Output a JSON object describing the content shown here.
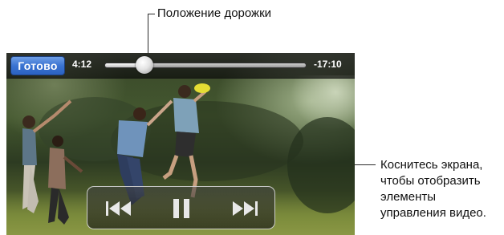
{
  "callouts": {
    "scrubber": "Положение дорожки",
    "tap_lines": [
      "Коснитесь экрана,",
      "чтобы отобразить",
      "элементы",
      "управления видео."
    ]
  },
  "player": {
    "done_label": "Готово",
    "elapsed": "4:12",
    "remaining": "-17:10",
    "progress_fraction": 0.2
  },
  "controls": {
    "previous_icon": "previous-track-icon",
    "pause_icon": "pause-icon",
    "next_icon": "next-track-icon"
  },
  "colors": {
    "done_button": "#3a73d1",
    "controls_icon": "#e8e8e8"
  }
}
